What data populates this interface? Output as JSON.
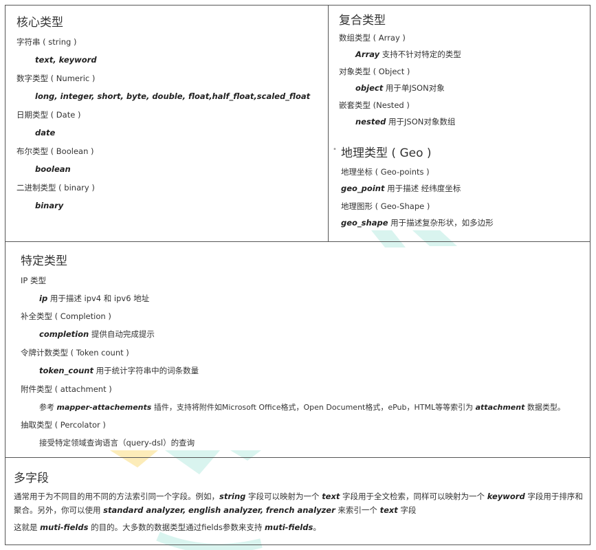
{
  "core": {
    "title": "核心类型",
    "items": [
      {
        "label": "字符串 ( string )",
        "types": "text, keyword",
        "desc": ""
      },
      {
        "label": "数字类型 ( Numeric )",
        "types": "long, integer, short, byte, double, float,half_float,scaled_float",
        "desc": ""
      },
      {
        "label": "日期类型 ( Date )",
        "types": "date",
        "desc": ""
      },
      {
        "label": "布尔类型 ( Boolean )",
        "types": "boolean",
        "desc": ""
      },
      {
        "label": "二进制类型 ( binary )",
        "types": "binary",
        "desc": ""
      }
    ]
  },
  "complex": {
    "title": "复合类型",
    "items": [
      {
        "label": "数组类型 ( Array )",
        "types": "Array",
        "desc": " 支持不针对特定的类型"
      },
      {
        "label": "对象类型 ( Object )",
        "types": "object",
        "desc": " 用于单JSON对象"
      },
      {
        "label": "嵌套类型 (Nested )",
        "types": "nested",
        "desc": " 用于JSON对象数组"
      }
    ]
  },
  "geo": {
    "title": "地理类型 ( Geo )",
    "items": [
      {
        "label": "地理坐标 ( Geo-points )",
        "types": "geo_point",
        "desc": " 用于描述 经纬度坐标"
      },
      {
        "label": "地理图形 ( Geo-Shape )",
        "types": "geo_shape",
        "desc": " 用于描述复杂形状，如多边形"
      }
    ]
  },
  "specific": {
    "title": "特定类型",
    "items": [
      {
        "label": "IP 类型",
        "pre": "",
        "types": "ip",
        "desc": " 用于描述 ipv4 和 ipv6 地址",
        "types2": "",
        "desc2": ""
      },
      {
        "label": "补全类型 ( Completion )",
        "pre": "",
        "types": "completion",
        "desc": " 提供自动完成提示",
        "types2": "",
        "desc2": ""
      },
      {
        "label": "令牌计数类型 ( Token count )",
        "pre": "",
        "types": "token_count",
        "desc": " 用于统计字符串中的词条数量",
        "types2": "",
        "desc2": ""
      },
      {
        "label": "附件类型 ( attachment )",
        "pre": "参考 ",
        "types": "mapper-attachements",
        "desc": " 插件，支持将附件如Microsoft Office格式，Open Document格式，ePub，HTML等等索引为 ",
        "types2": "attachment",
        "desc2": " 数据类型。"
      },
      {
        "label": "抽取类型 ( Percolator )",
        "pre": "接受特定领域查询语言（query-dsl）的查询",
        "types": "",
        "desc": "",
        "types2": "",
        "desc2": ""
      }
    ]
  },
  "multi": {
    "title": "多字段",
    "p1": {
      "a": "通常用于为不同目的用不同的方法索引同一个字段。例如，",
      "k1": "string",
      "b": " 字段可以映射为一个 ",
      "k2": "text",
      "c": " 字段用于全文检索，同样可以映射为一个 ",
      "k3": "keyword",
      "d": " 字段用于排序和聚合。另外，你可以使用 ",
      "k4": "standard analyzer,",
      "e": "  ",
      "k5": "english analyzer,",
      "f": "  ",
      "k6": "french analyzer",
      "g": " 来索引一个 ",
      "k7": "text",
      "h": " 字段"
    },
    "p2": {
      "a": "这就是 ",
      "k1": "muti-fields",
      "b": " 的目的。大多数的数据类型通过fields参数来支持 ",
      "k2": "muti-fields",
      "c": "。"
    }
  },
  "colors": {
    "border": "#555555",
    "text": "#333333",
    "watermark_teal": "#7fd9c9",
    "watermark_yellow": "#f7d36b"
  }
}
